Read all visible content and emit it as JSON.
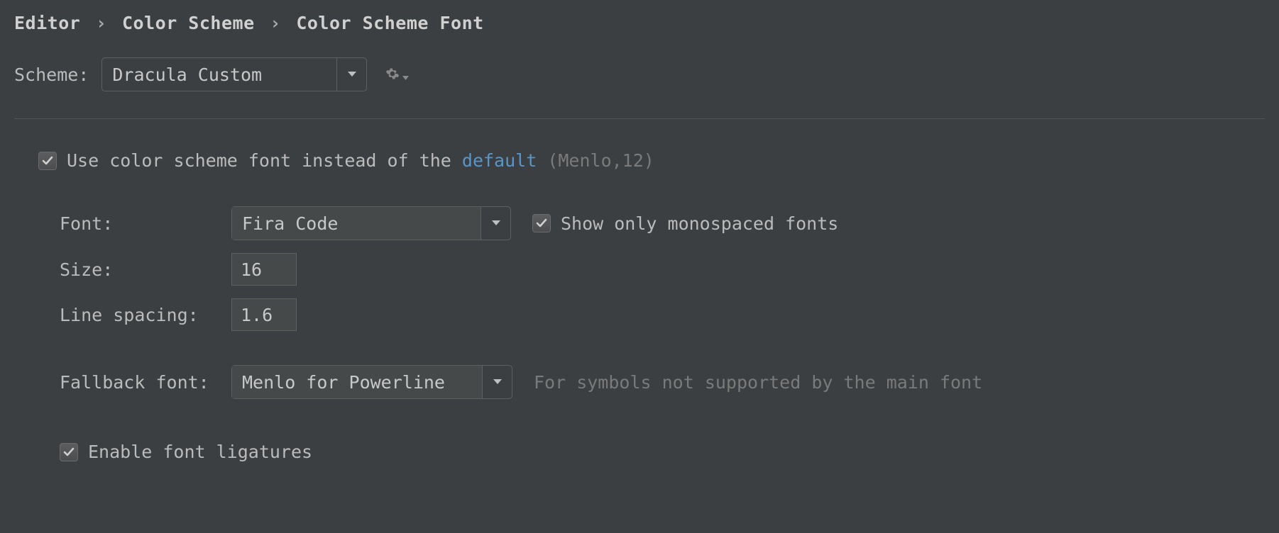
{
  "breadcrumb": {
    "item0": "Editor",
    "item1": "Color Scheme",
    "item2": "Color Scheme Font"
  },
  "scheme": {
    "label": "Scheme:",
    "value": "Dracula Custom"
  },
  "use_scheme_font": {
    "checked": true,
    "text_prefix": "Use color scheme font instead of the ",
    "link": "default",
    "suffix": " (Menlo,12)"
  },
  "font": {
    "label": "Font:",
    "value": "Fira Code"
  },
  "show_mono": {
    "checked": true,
    "label": "Show only monospaced fonts"
  },
  "size": {
    "label": "Size:",
    "value": "16"
  },
  "line_spacing": {
    "label": "Line spacing:",
    "value": "1.6"
  },
  "fallback": {
    "label": "Fallback font:",
    "value": "Menlo for Powerline",
    "hint": "For symbols not supported by the main font"
  },
  "ligatures": {
    "checked": true,
    "label": "Enable font ligatures"
  }
}
